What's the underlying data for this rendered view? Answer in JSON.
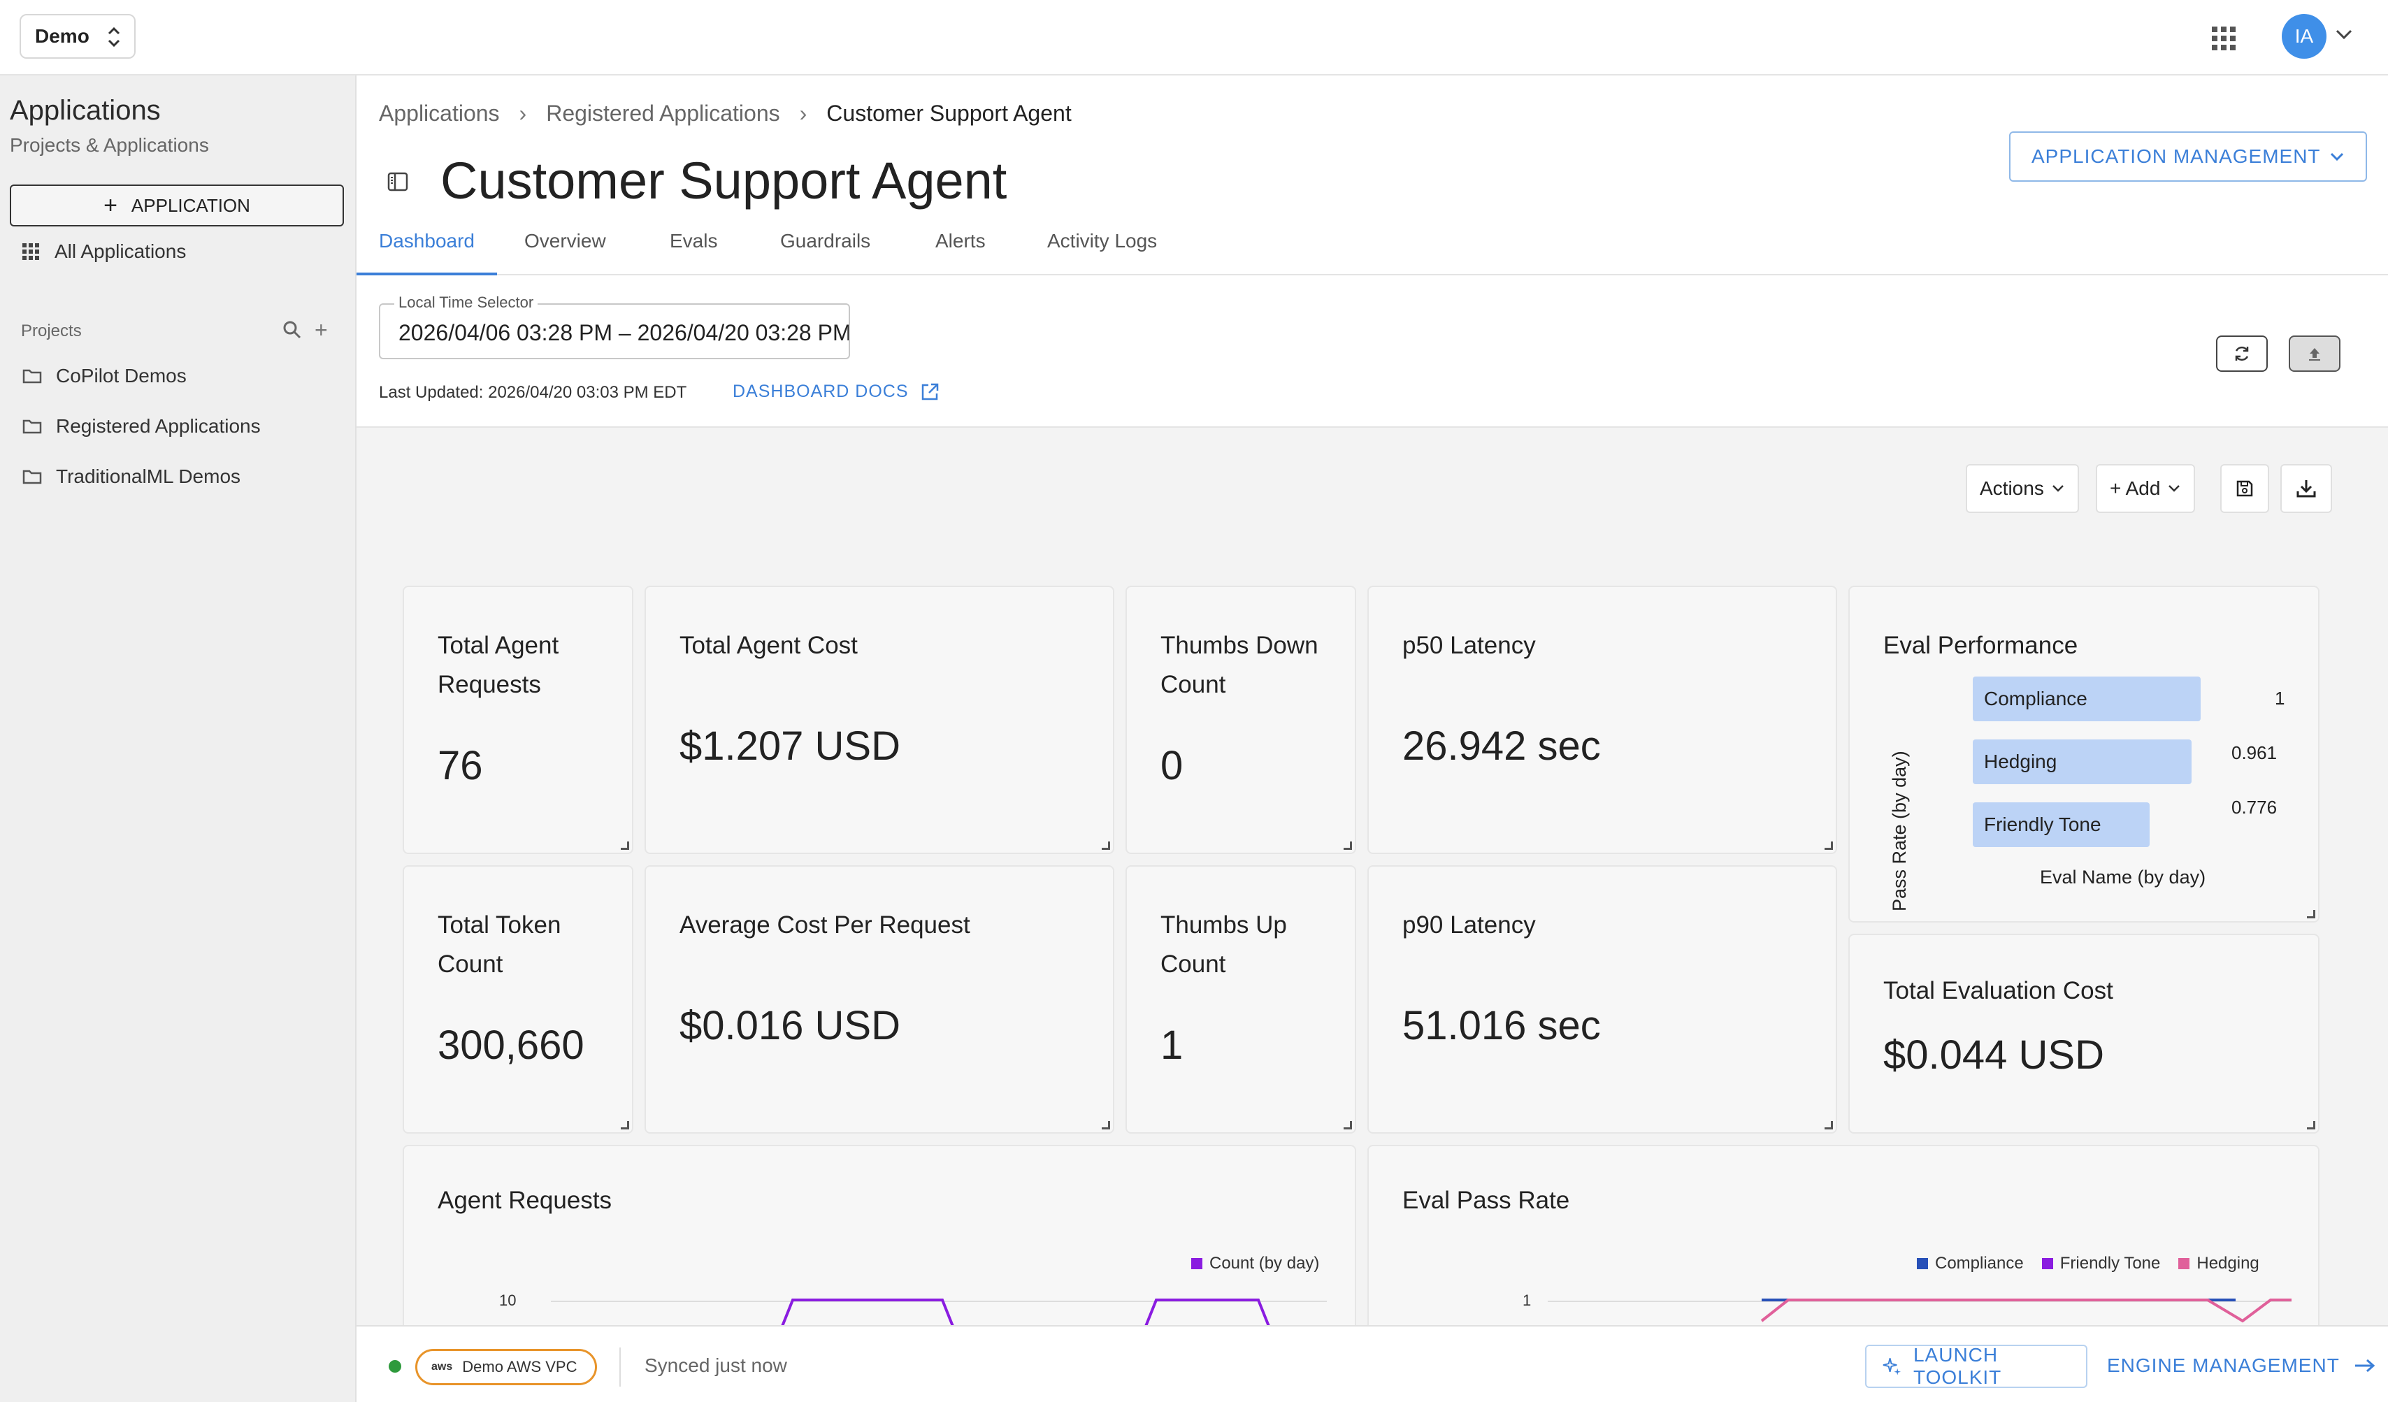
{
  "topbar": {
    "workspace": "Demo",
    "avatar_initials": "IA"
  },
  "sidebar": {
    "title": "Applications",
    "subtitle": "Projects & Applications",
    "new_button": "APPLICATION",
    "all_apps": "All Applications",
    "projects_label": "Projects",
    "projects": [
      "CoPilot Demos",
      "Registered Applications",
      "TraditionalML Demos"
    ]
  },
  "breadcrumb": [
    "Applications",
    "Registered Applications",
    "Customer Support Agent"
  ],
  "page": {
    "title": "Customer Support Agent",
    "app_management": "APPLICATION MANAGEMENT",
    "tabs": [
      "Dashboard",
      "Overview",
      "Evals",
      "Guardrails",
      "Alerts",
      "Activity Logs"
    ],
    "active_tab": "Dashboard"
  },
  "time_selector": {
    "label": "Local Time Selector",
    "value": "2026/04/06 03:28 PM – 2026/04/20 03:28 PM"
  },
  "last_updated": "Last Updated: 2026/04/20 03:03 PM EDT",
  "docs_link": "DASHBOARD DOCS",
  "toolbar": {
    "actions": "Actions",
    "add": "+ Add"
  },
  "metrics": {
    "total_agent_requests": {
      "title": "Total Agent Requests",
      "value": "76"
    },
    "total_agent_cost": {
      "title": "Total Agent Cost",
      "value": "$1.207 USD"
    },
    "thumbs_down": {
      "title": "Thumbs Down Count",
      "value": "0"
    },
    "p50_latency": {
      "title": "p50 Latency",
      "value": "26.942 sec"
    },
    "total_token_count": {
      "title": "Total Token Count",
      "value": "300,660"
    },
    "avg_cost": {
      "title": "Average Cost Per Request",
      "value": "$0.016 USD"
    },
    "thumbs_up": {
      "title": "Thumbs Up Count",
      "value": "1"
    },
    "p90_latency": {
      "title": "p90 Latency",
      "value": "51.016 sec"
    },
    "total_eval_cost": {
      "title": "Total Evaluation Cost",
      "value": "$0.044 USD"
    }
  },
  "eval_performance": {
    "title": "Eval Performance",
    "ylabel": "Pass Rate (by day)",
    "xlabel": "Eval Name (by day)",
    "bars": [
      {
        "name": "Compliance",
        "value": 1,
        "label": "1"
      },
      {
        "name": "Hedging",
        "value": 0.961,
        "label": "0.961"
      },
      {
        "name": "Friendly Tone",
        "value": 0.776,
        "label": "0.776"
      }
    ]
  },
  "agent_requests": {
    "title": "Agent Requests",
    "legend": "Count (by day)",
    "legend_color": "#8a1ce0",
    "ytick": "10"
  },
  "eval_pass_rate": {
    "title": "Eval Pass Rate",
    "legend": [
      {
        "name": "Compliance",
        "color": "#2750b8"
      },
      {
        "name": "Friendly Tone",
        "color": "#8a1ce0"
      },
      {
        "name": "Hedging",
        "color": "#e0609a"
      }
    ],
    "ytick": "1"
  },
  "footer": {
    "aws_label": "aws",
    "vpc": "Demo AWS VPC",
    "status": "Synced just now",
    "launch": "LAUNCH TOOLKIT",
    "engine": "ENGINE MANAGEMENT"
  },
  "colors": {
    "accent": "#3b7fd8",
    "bar": "#bcd3f6",
    "status": "#2e9a3c",
    "aws": "#e8942a"
  }
}
